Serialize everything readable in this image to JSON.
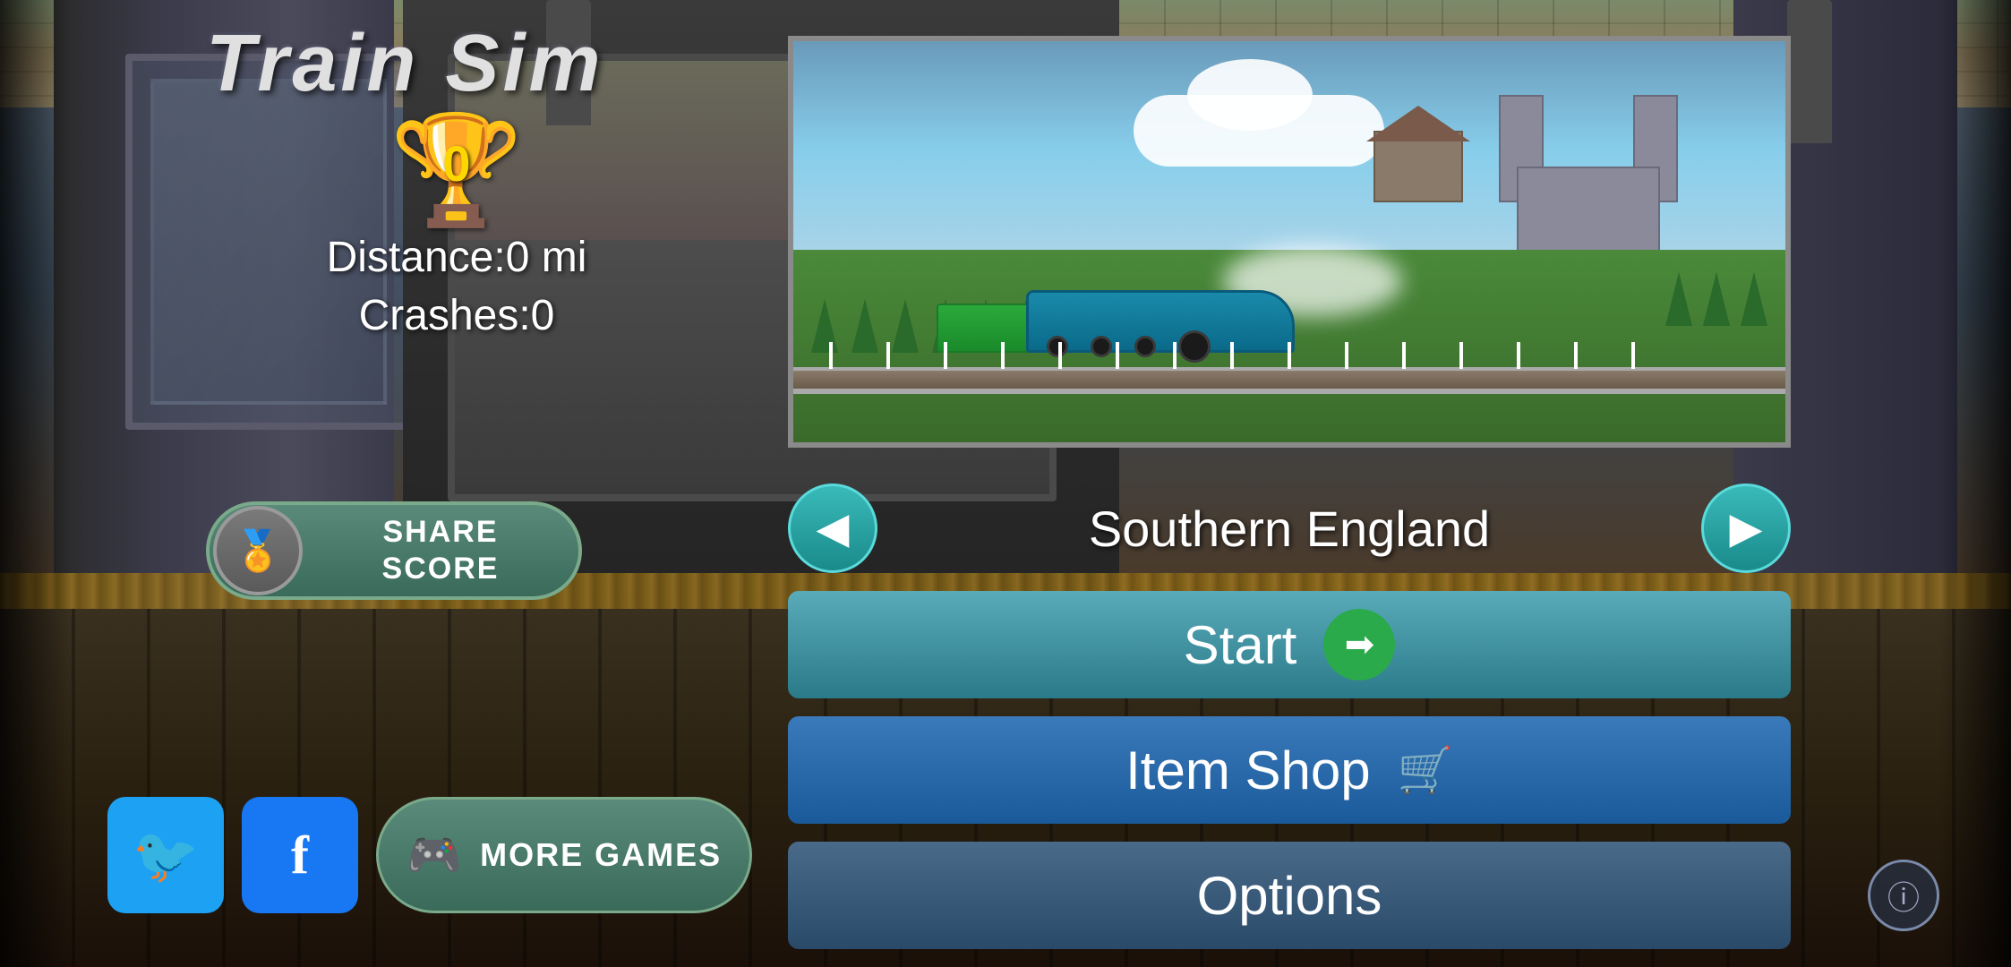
{
  "app": {
    "title": "Train Sim"
  },
  "stats": {
    "trophy_count": "0",
    "distance_label": "Distance:0 mi",
    "crashes_label": "Crashes:0"
  },
  "share_score": {
    "label_line1": "SHARE",
    "label_line2": "SCORE",
    "icon": "🏆"
  },
  "social": {
    "twitter_icon": "🐦",
    "facebook_label": "f",
    "more_games_label": "MORE GAMES"
  },
  "location": {
    "name": "Southern England",
    "prev_arrow": "◀",
    "next_arrow": "▶"
  },
  "buttons": {
    "start_label": "Start",
    "item_shop_label": "Item Shop",
    "options_label": "Options",
    "info_label": "ⓘ"
  },
  "preview": {
    "alt": "Train gameplay preview - blue train on green countryside"
  }
}
